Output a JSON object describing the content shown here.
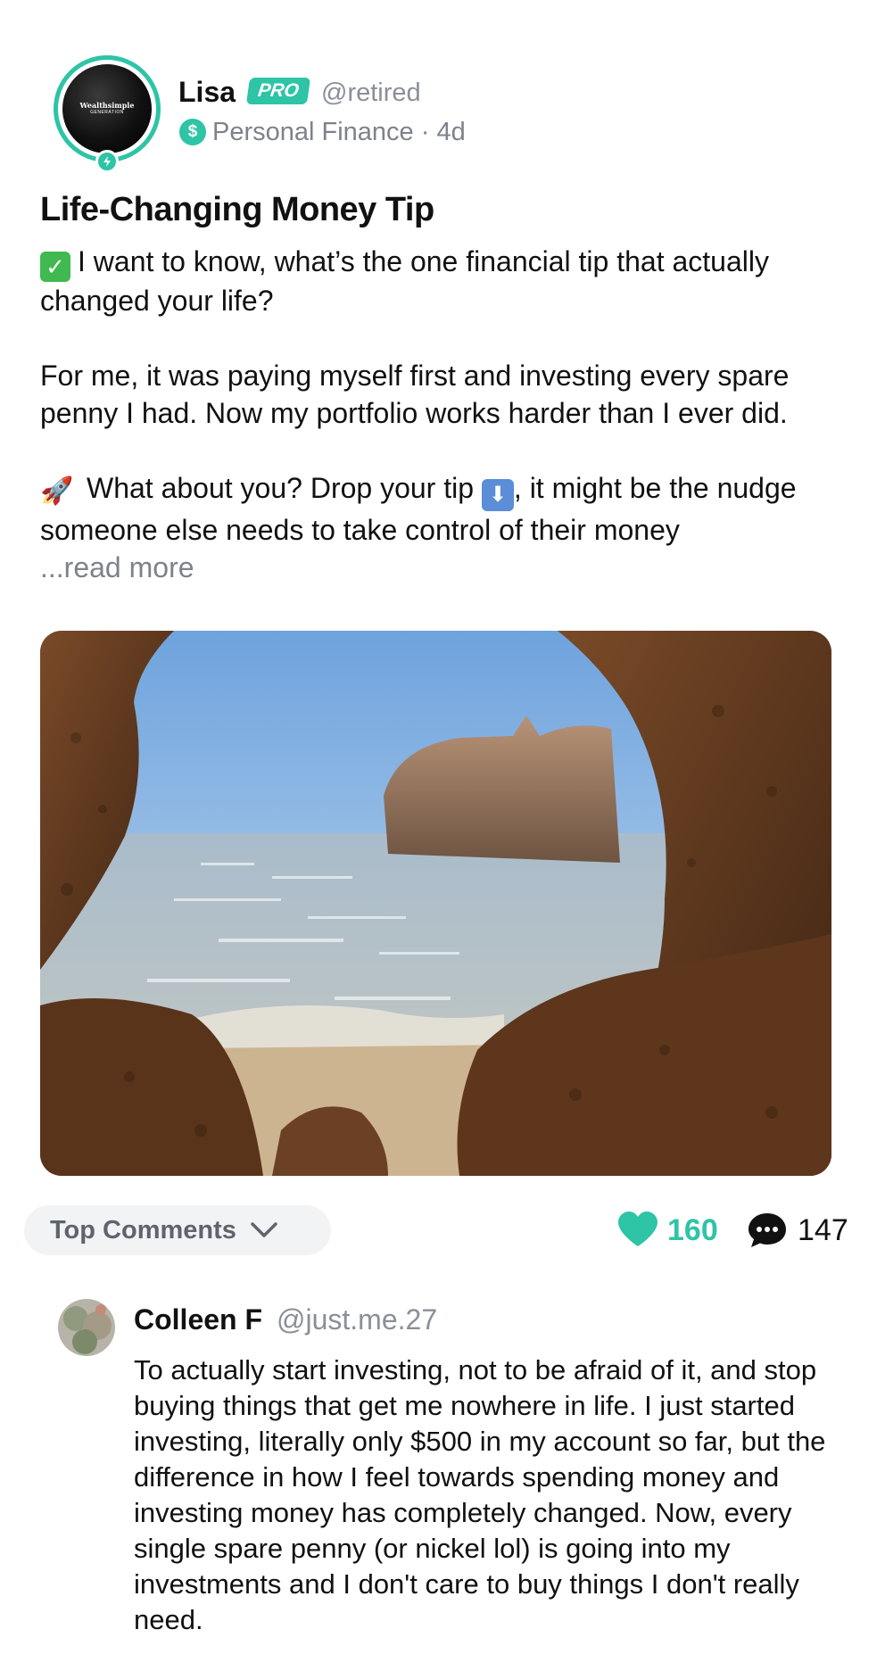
{
  "author": {
    "name": "Lisa",
    "badge": "PRO",
    "handle": "@retired",
    "category": "Personal Finance",
    "separator": "·",
    "age": "4d",
    "avatar_logo_line1": "Wealthsimple",
    "avatar_logo_line2": "GENERATION"
  },
  "post": {
    "title": "Life-Changing Money Tip",
    "line1": "I want to know, what’s the one financial tip that actually changed your life?",
    "line2": "For me, it was paying myself first and investing every spare penny I had. Now my portfolio works harder than I ever did.",
    "line3_a": "What about you? Drop your tip",
    "line3_b": ", it might be the nudge someone else needs to take control of their money",
    "read_more": "...read more",
    "emoji_check": "✓",
    "emoji_rocket": "🚀",
    "emoji_down": "⬇"
  },
  "actions": {
    "sort_label": "Top Comments",
    "like_count": "160",
    "comment_count": "147"
  },
  "comment": {
    "name": "Colleen F",
    "handle": "@just.me.27",
    "text": "To actually start investing, not to be afraid of it, and stop buying things that get me nowhere in life. I just started investing, literally only $500 in my account so far, but the difference in how I feel towards spending money and investing money has completely changed. Now, every single spare penny (or nickel lol) is going into my investments and I don't care to buy things I don't really need."
  },
  "colors": {
    "accent": "#2ec4a6",
    "muted_text": "#7d828b",
    "text": "#111111"
  },
  "icons": [
    "bolt-icon",
    "dollar-icon",
    "chevron-down-icon",
    "heart-icon",
    "comment-bubble-icon"
  ]
}
